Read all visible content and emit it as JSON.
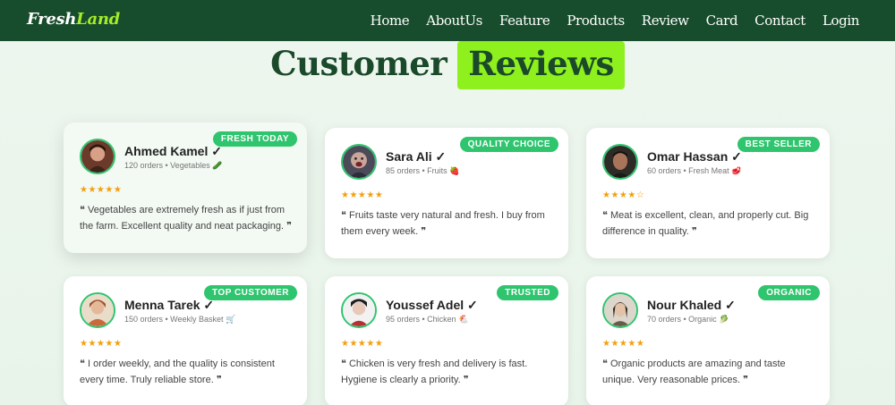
{
  "nav": {
    "logo_main": "Fresh",
    "logo_accent": "Land",
    "items": [
      "Home",
      "AboutUs",
      "Feature",
      "Products",
      "Review",
      "Card",
      "Contact",
      "Login"
    ]
  },
  "heading": {
    "word1": "Customer",
    "word2": "Reviews"
  },
  "reviews": [
    {
      "badge": "FRESH TODAY",
      "name": "Ahmed Kamel ✓",
      "meta": "120 orders • Vegetables 🥒",
      "stars": "★★★★★",
      "quote": "❝ Vegetables are extremely fresh as if just from the farm. Excellent quality and neat packaging. ❞"
    },
    {
      "badge": "QUALITY CHOICE",
      "name": "Sara Ali ✓",
      "meta": "85 orders • Fruits 🍓",
      "stars": "★★★★★",
      "quote": "❝ Fruits taste very natural and fresh. I buy from them every week. ❞"
    },
    {
      "badge": "BEST SELLER",
      "name": "Omar Hassan ✓",
      "meta": "60 orders • Fresh Meat 🥩",
      "stars": "★★★★☆",
      "quote": "❝ Meat is excellent, clean, and properly cut. Big difference in quality. ❞"
    },
    {
      "badge": "TOP CUSTOMER",
      "name": "Menna Tarek ✓",
      "meta": "150 orders • Weekly Basket 🛒",
      "stars": "★★★★★",
      "quote": "❝ I order weekly, and the quality is consistent every time. Truly reliable store. ❞"
    },
    {
      "badge": "TRUSTED",
      "name": "Youssef Adel ✓",
      "meta": "95 orders • Chicken 🐔",
      "stars": "★★★★★",
      "quote": "❝ Chicken is very fresh and delivery is fast. Hygiene is clearly a priority. ❞"
    },
    {
      "badge": "ORGANIC",
      "name": "Nour Khaled ✓",
      "meta": "70 orders • Organic 🥬",
      "stars": "★★★★★",
      "quote": "❝ Organic products are amazing and taste unique. Very reasonable prices. ❞"
    }
  ],
  "colors": {
    "nav_bg": "#174d2c",
    "logo_accent": "#a6ec2a",
    "heading_highlight": "#8ef01c",
    "badge": "#2fc46e",
    "stars": "#f1a010"
  }
}
